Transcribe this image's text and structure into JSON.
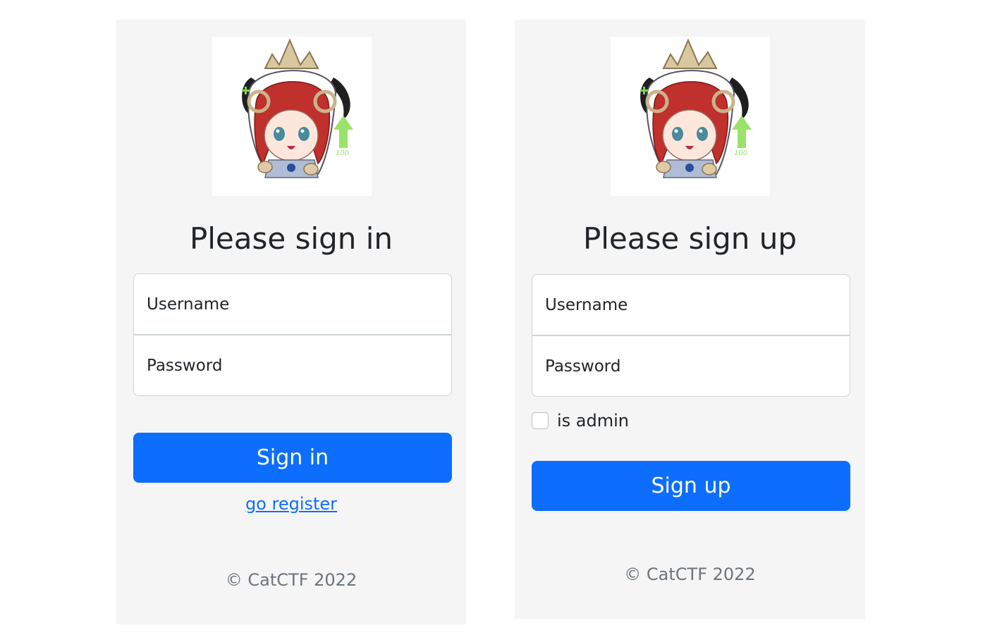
{
  "signin": {
    "title": "Please sign in",
    "username_placeholder": "Username",
    "password_placeholder": "Password",
    "button_label": "Sign in",
    "register_link": "go register",
    "footer": "© CatCTF 2022"
  },
  "signup": {
    "title": "Please sign up",
    "username_placeholder": "Username",
    "password_placeholder": "Password",
    "checkbox_label": "is admin",
    "checkbox_checked": false,
    "button_label": "Sign up",
    "footer": "© CatCTF 2022"
  },
  "avatar": {
    "badge_text": "100"
  },
  "colors": {
    "primary": "#0d6efd",
    "panel_bg": "#f5f5f5",
    "muted_text": "#6c757d",
    "hair": "#c0302c",
    "accent_green": "#9be26a"
  }
}
